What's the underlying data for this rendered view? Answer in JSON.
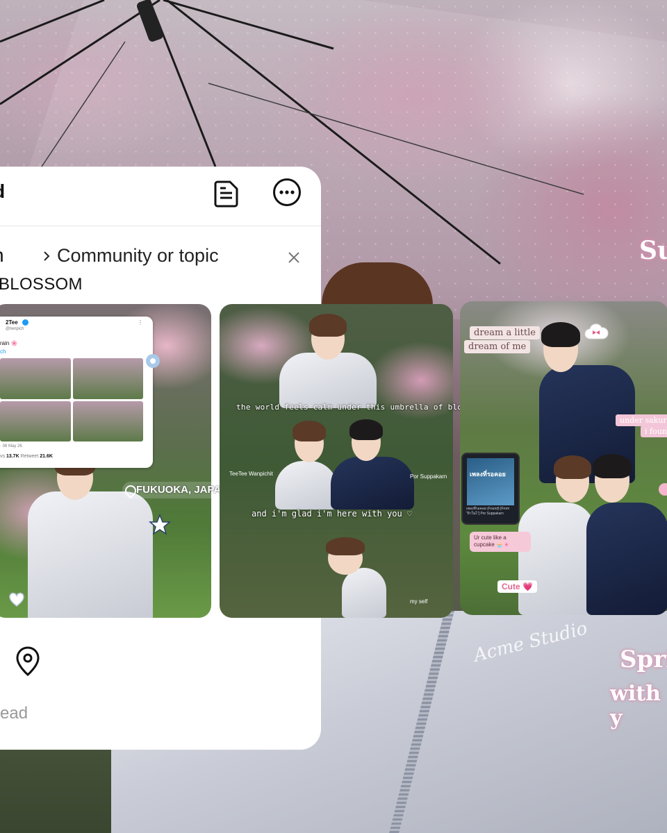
{
  "background": {
    "script_top": "Su",
    "script_bottom_1": "Sprin",
    "script_bottom_2": "with y",
    "jacket_logo": "Acme Studio"
  },
  "panel": {
    "header_title": "ead",
    "author_fragment": "n",
    "topic_label": "Community or topic",
    "tag_text": "BLOSSOM",
    "footer_fragment": "ead"
  },
  "tweet": {
    "name": "2Tee",
    "handle": "@twnpich",
    "text": "rain 🌸",
    "text_link": "ch",
    "date": "· 06 May 26",
    "retweets_value": "13.7K",
    "retweets_label": "Retweet",
    "likes_value": "21.6K",
    "stats_prefix": "vs"
  },
  "card1": {
    "location": "FUKUOKA, JAPAN"
  },
  "card2": {
    "caption_world": "the world feels calm under this umbrella of blossoms",
    "label_teetee": "TeeTee Wanpichit",
    "label_por": "Por Suppakarn",
    "caption_glad": "and i'm glad i'm here with you ♡",
    "label_myself": "my self"
  },
  "card3": {
    "dream_line1": "dream a little",
    "dream_line2": "dream of me",
    "under_sakura": "under sakur",
    "i_found": "i foun",
    "music_title": "เพลงที่รอคอย",
    "music_meta": "เพลงที่รอคอย (Found) [From \"ฝ้าในไ\"] Por Suppakarn",
    "chat_text": "Ur cute like a cupcake 🧁🌸",
    "cute_label": "Cute 💗"
  },
  "colors": {
    "panel_bg": "#ffffff",
    "text_primary": "#111111",
    "sticker_pink": "#f2c6d8",
    "navy_jacket": "#1c2748"
  }
}
